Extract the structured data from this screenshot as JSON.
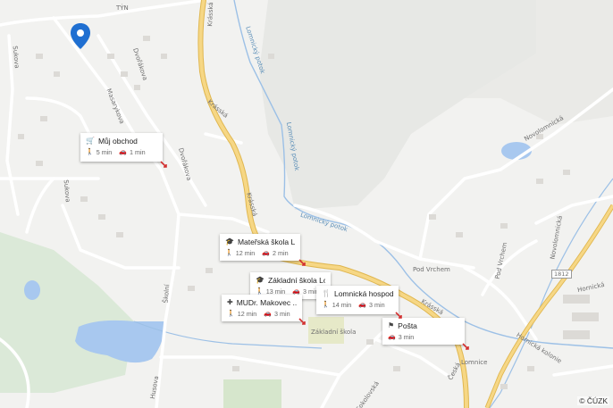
{
  "map": {
    "copyright": "© ČÚZK",
    "pin_color": "#1f6fd1",
    "water_color": "#a8c8ef",
    "forest_color": "#e3e4e1",
    "road_color": "#f3cf6e"
  },
  "street_labels": {
    "tyn": "TÝN",
    "dvorakova1": "Dvořákova",
    "dvorakova2": "Dvořákova",
    "masarykova": "Masarykova",
    "sukova1": "Sukova",
    "sukova2": "Sukova",
    "krasska1": "Krásská",
    "krasska2": "Krásská",
    "krasska3": "Krásská",
    "krasska4": "Krásská",
    "lomnicky_potok1": "Lomnický potok",
    "lomnicky_potok2": "Lomnický potok",
    "lomnicky_potok3": "Lomnický potok",
    "novolomnicka": "Novolomnická",
    "pod_vrchem": "Pod Vrchem",
    "pod_vrchem2": "Pod Vrchem",
    "nadrazni": "Nádražní",
    "novolomnicka2": "Novolomnická",
    "hornicka": "Hornická",
    "hornicka_kolonie": "Hornická kolonie",
    "ceska": "Česká",
    "sokolovska": "Sokolovská",
    "skolni": "Školní",
    "husova": "Husova",
    "zakladni_skola": "Základní škola",
    "lomnice": "Lomnice",
    "road_number": "1812"
  },
  "pois": [
    {
      "title": "Můj obchod",
      "icon": "cart-icon",
      "walk": "5 min",
      "car": "1 min"
    },
    {
      "title": "Mateřská škola L...",
      "icon": "school-icon",
      "walk": "12 min",
      "car": "2 min"
    },
    {
      "title": "Základní škola Lo...",
      "icon": "school-icon",
      "walk": "13 min",
      "car": "3 min"
    },
    {
      "title": "MUDr. Makovec ...",
      "icon": "medical-icon",
      "walk": "12 min",
      "car": "3 min"
    },
    {
      "title": "Lomnická hospoda",
      "icon": "restaurant-icon",
      "walk": "14 min",
      "car": "3 min"
    },
    {
      "title": "Pošta",
      "icon": "post-office-icon",
      "walk": "",
      "car": "3 min"
    }
  ]
}
